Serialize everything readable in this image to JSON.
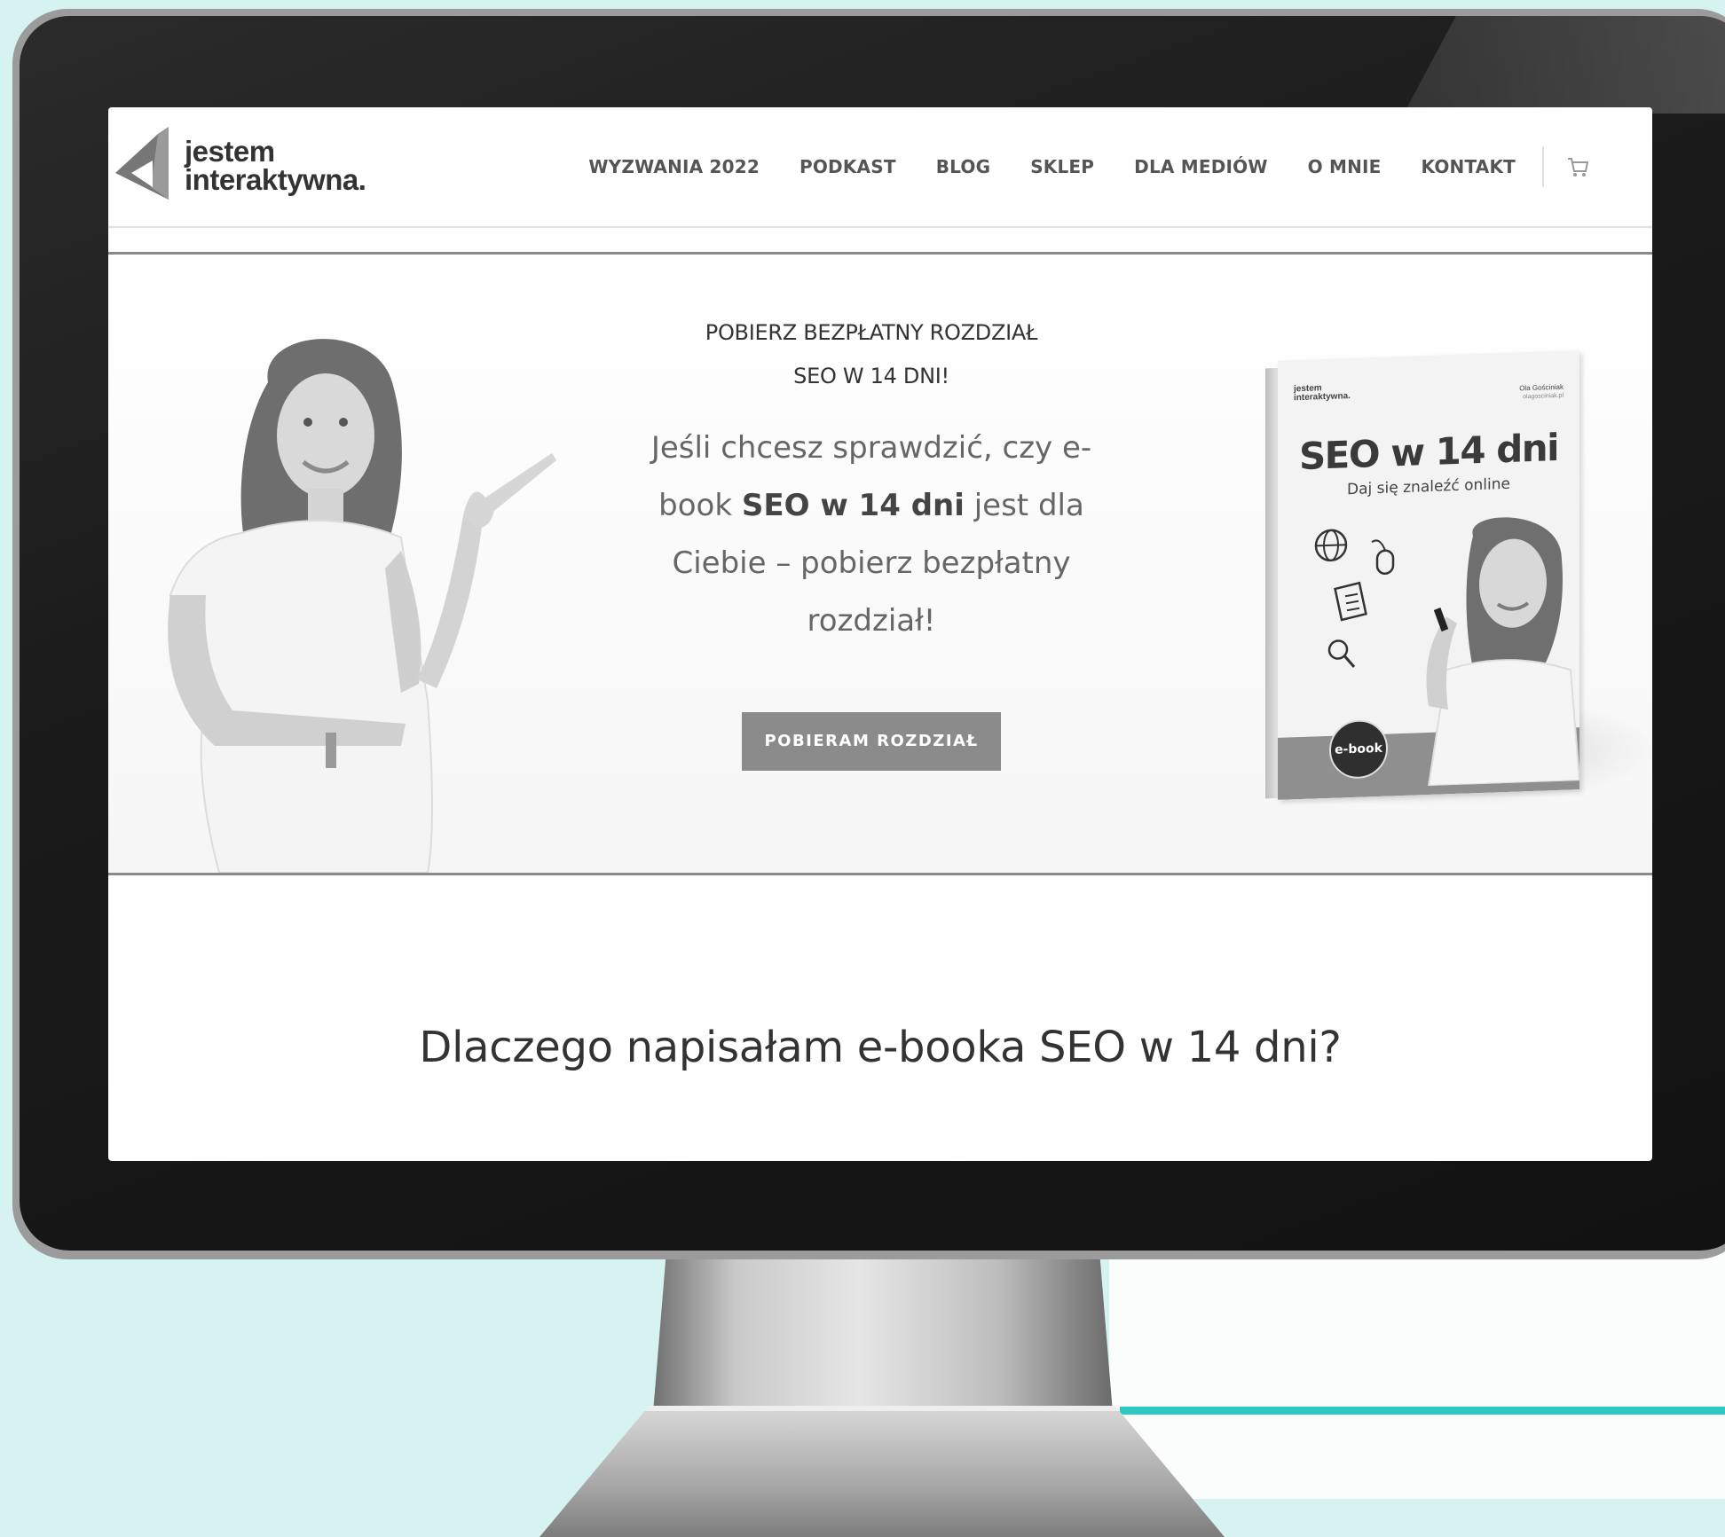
{
  "logo": {
    "line1": "jestem",
    "line2": "interaktywna."
  },
  "nav": {
    "items": [
      "WYZWANIA 2022",
      "PODKAST",
      "BLOG",
      "SKLEP",
      "DLA MEDIÓW",
      "O MNIE",
      "KONTAKT"
    ],
    "cart_icon": "cart-icon"
  },
  "hero": {
    "kicker_line1": "POBIERZ BEZPŁATNY ROZDZIAŁ",
    "kicker_line2": "SEO W 14 DNI!",
    "lead_part1": "Jeśli chcesz sprawdzić, czy e-book ",
    "lead_bold": "SEO w 14 dni",
    "lead_part2": " jest dla Ciebie – pobierz bezpłatny rozdział!",
    "cta_label": "POBIERAM ROZDZIAŁ"
  },
  "book": {
    "logo_line1": "jestem",
    "logo_line2": "interaktywna.",
    "author": "Ola Gościniak",
    "author_site": "olagosciniak.pl",
    "title": "SEO w 14 dni",
    "subtitle": "Daj się znaleźć online",
    "badge": "e-book"
  },
  "section": {
    "heading": "Dlaczego napisałam e-booka SEO w 14 dni?"
  },
  "colors": {
    "background": "#d6f2f1",
    "accent_line": "#2ec8c2",
    "button": "#8b8b8b"
  }
}
